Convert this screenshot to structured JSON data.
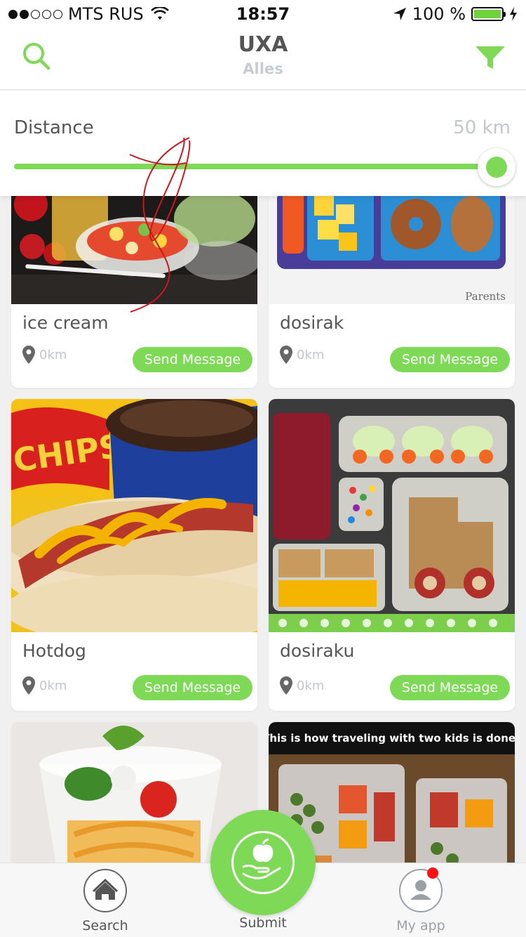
{
  "status_bar": {
    "carrier": "MTS RUS",
    "time": "18:57",
    "battery_percent": "100 %",
    "signal_dots_filled": 2,
    "signal_dots_total": 5
  },
  "header": {
    "title": "UXA",
    "subtitle": "Alles",
    "left_icon": "search-icon",
    "right_icon": "filter-icon"
  },
  "distance": {
    "label": "Distance",
    "value": "50 km",
    "slider_fraction": 1.0
  },
  "cards": [
    {
      "title": "ice cream",
      "distance": "0km",
      "button": "Send Message",
      "image": "fruit salad cups"
    },
    {
      "title": "dosirak",
      "distance": "0km",
      "button": "Send Message",
      "image": "lunchbox with pineapple and bagel",
      "image_caption": "Parents"
    },
    {
      "title": "Hotdog",
      "distance": "0km",
      "button": "Send Message",
      "image": "hotdog with chips and soda"
    },
    {
      "title": "dosiraku",
      "distance": "0km",
      "button": "Send Message",
      "image": "bento lunchbox with car-shaped sandwich"
    },
    {
      "title": "",
      "distance": "",
      "button": "",
      "image": "salad cup"
    },
    {
      "title": "",
      "distance": "",
      "button": "",
      "image": "travel snack boxes",
      "image_caption": "This is how traveling with two kids is done!"
    }
  ],
  "tabs": {
    "search": {
      "label": "Search",
      "icon": "home-icon"
    },
    "submit": {
      "label": "Submit",
      "icon": "apple-hand-icon"
    },
    "myapp": {
      "label": "My app",
      "icon": "user-icon"
    }
  },
  "colors": {
    "accent": "#7ed957",
    "title_text": "#555555",
    "muted_text": "#c2c7cc",
    "badge": "#ff1111"
  }
}
